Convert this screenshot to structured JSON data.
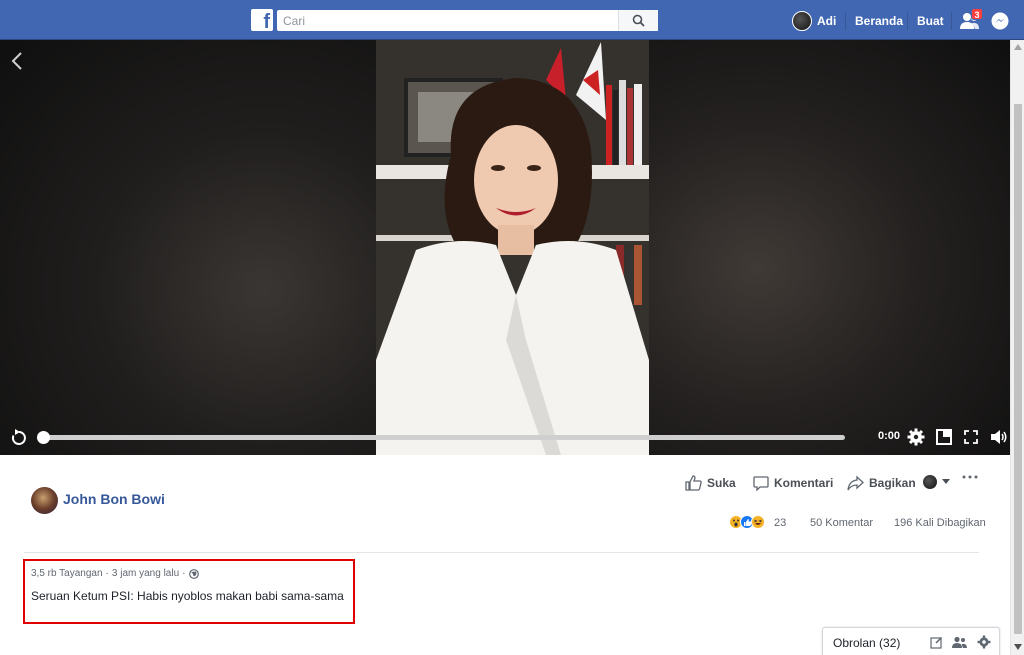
{
  "topbar": {
    "logo_letter": "f",
    "search_placeholder": "Cari",
    "profile_name": "Adi",
    "home_label": "Beranda",
    "create_label": "Buat",
    "friend_requests_count": "3"
  },
  "video": {
    "time": "0:00",
    "progress": 0
  },
  "post": {
    "author": "John Bon Bowi",
    "actions": {
      "like": "Suka",
      "comment": "Komentari",
      "share": "Bagikan"
    },
    "reactions_count": "23",
    "comments_count": "50 Komentar",
    "shares_count": "196 Kali Dibagikan",
    "views": "3,5 rb Tayangan",
    "time_ago": "3 jam yang lalu",
    "separator": "·",
    "caption": "Seruan Ketum PSI: Habis nyoblos makan babi sama-sama"
  },
  "chat": {
    "label": "Obrolan (32)"
  },
  "colors": {
    "brand": "#4267b2",
    "link": "#365899",
    "highlight": "#e00000"
  },
  "icons": [
    "search-icon",
    "friends-icon",
    "messenger-icon",
    "back-icon",
    "replay-icon",
    "settings-icon",
    "miniplayer-icon",
    "fullscreen-icon",
    "volume-icon",
    "like-icon",
    "comment-icon",
    "share-icon",
    "globe-icon",
    "compose-icon",
    "group-icon",
    "gear-icon"
  ]
}
